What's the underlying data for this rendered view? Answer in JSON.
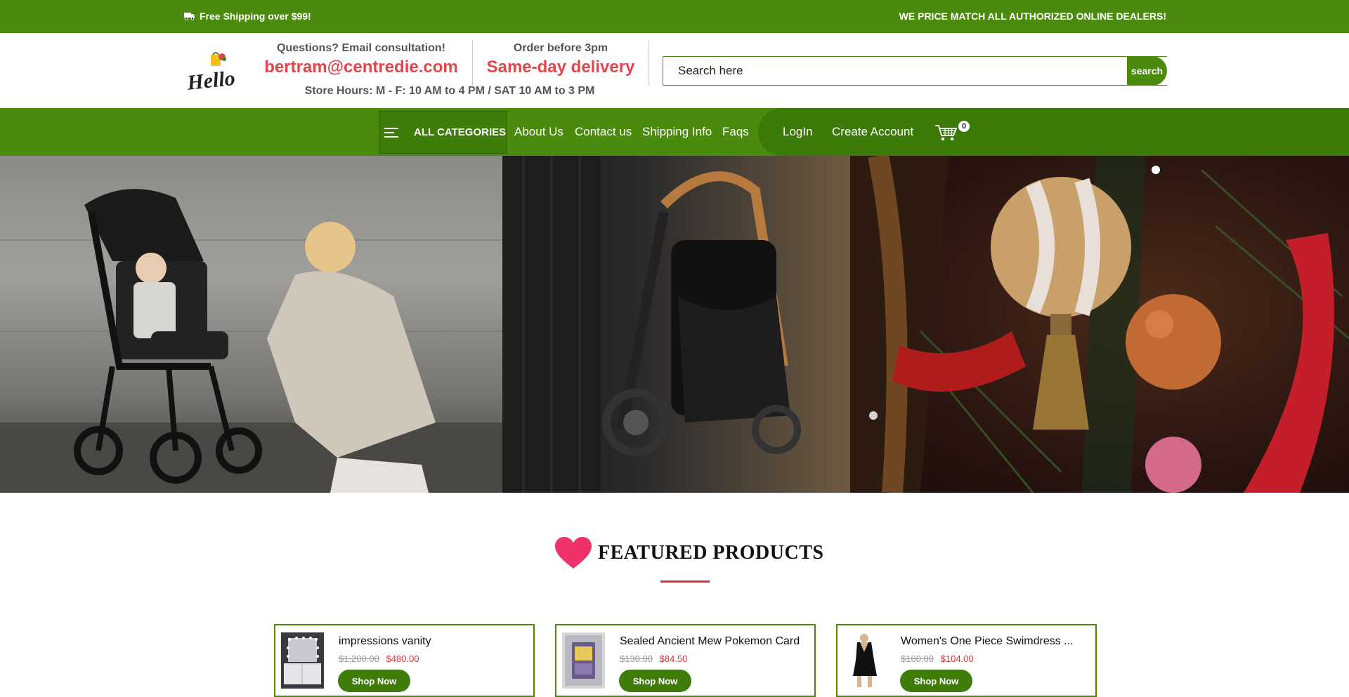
{
  "topbar": {
    "shipping": "Free Shipping over $99!",
    "price_match": "WE PRICE MATCH ALL AUTHORIZED ONLINE DEALERS!"
  },
  "header": {
    "logo_text": "Hello",
    "consult_label": "Questions? Email consultation!",
    "email": "bertram@centredie.com",
    "order_label": "Order before 3pm",
    "delivery": "Same-day delivery",
    "hours": "Store Hours: M - F: 10 AM to 4 PM / SAT 10 AM to 3 PM",
    "search_placeholder": "Search here",
    "search_button": "search"
  },
  "nav": {
    "all_categories": "ALL CATEGORIES",
    "links": [
      "About Us",
      "Contact us",
      "Shipping Info",
      "Faqs"
    ],
    "login": "LogIn",
    "create_account": "Create Account",
    "cart_count": "0"
  },
  "featured": {
    "title": "FEATURED PRODUCTS",
    "products": [
      {
        "name": "impressions vanity",
        "old_price": "$1,200.00",
        "new_price": "$480.00",
        "button": "Shop Now"
      },
      {
        "name": "Sealed Ancient Mew Pokemon Card",
        "old_price": "$130.00",
        "new_price": "$84.50",
        "button": "Shop Now"
      },
      {
        "name": "Women's One Piece Swimdress ...",
        "old_price": "$160.00",
        "new_price": "$104.00",
        "button": "Shop Now"
      }
    ]
  },
  "colors": {
    "brand_green": "#4a8a0c",
    "accent_red": "#e0474c"
  }
}
